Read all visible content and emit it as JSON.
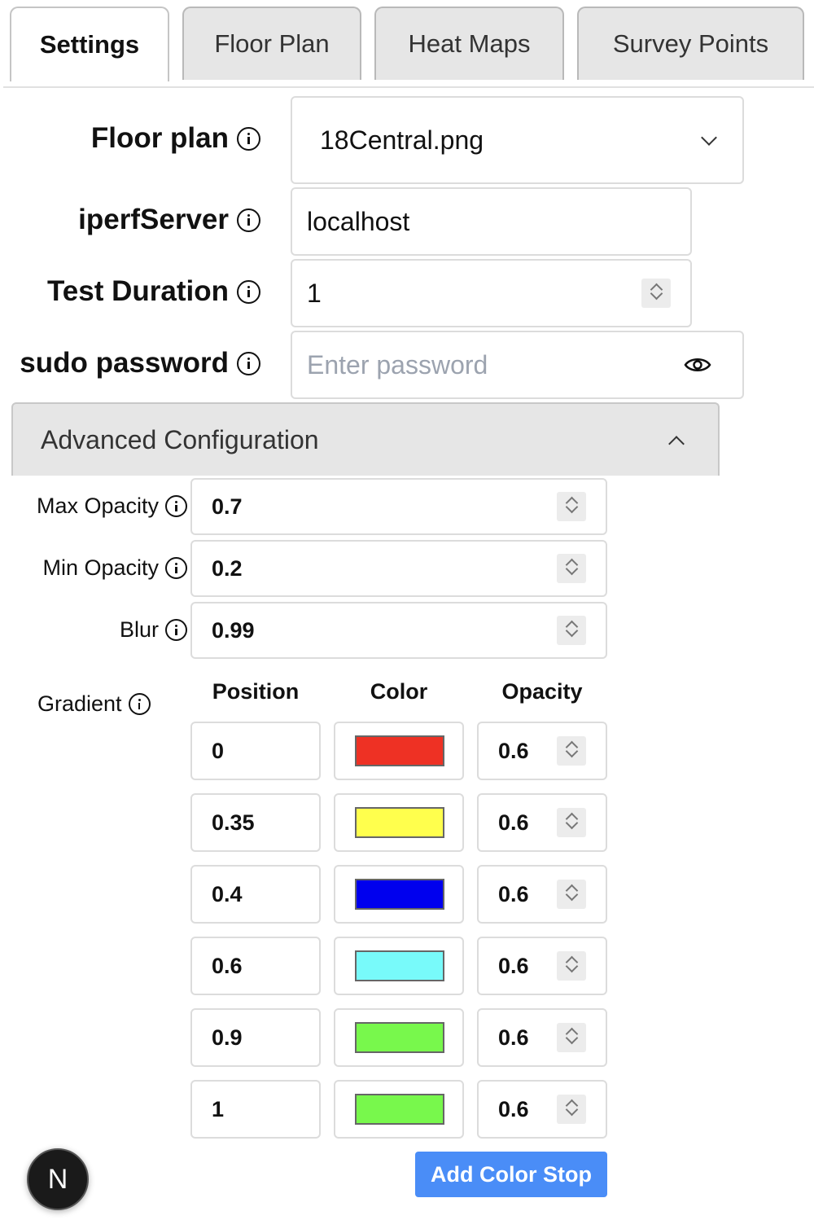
{
  "tabs": [
    {
      "label": "Settings",
      "active": true
    },
    {
      "label": "Floor Plan",
      "active": false
    },
    {
      "label": "Heat Maps",
      "active": false
    },
    {
      "label": "Survey Points",
      "active": false
    }
  ],
  "form": {
    "floor_plan": {
      "label": "Floor plan",
      "value": "18Central.png"
    },
    "iperf_server": {
      "label": "iperfServer",
      "value": "localhost"
    },
    "test_duration": {
      "label": "Test Duration",
      "value": "1"
    },
    "sudo_password": {
      "label": "sudo password",
      "placeholder": "Enter password",
      "value": ""
    }
  },
  "advanced": {
    "title": "Advanced Configuration",
    "expanded": true,
    "max_opacity": {
      "label": "Max Opacity",
      "value": "0.7"
    },
    "min_opacity": {
      "label": "Min Opacity",
      "value": "0.2"
    },
    "blur": {
      "label": "Blur",
      "value": "0.99"
    },
    "gradient": {
      "label": "Gradient",
      "headers": {
        "position": "Position",
        "color": "Color",
        "opacity": "Opacity"
      },
      "stops": [
        {
          "position": "0",
          "color": "#ee3124",
          "opacity": "0.6"
        },
        {
          "position": "0.35",
          "color": "#ffff4d",
          "opacity": "0.6"
        },
        {
          "position": "0.4",
          "color": "#0000ee",
          "opacity": "0.6"
        },
        {
          "position": "0.6",
          "color": "#78fafa",
          "opacity": "0.6"
        },
        {
          "position": "0.9",
          "color": "#78f84c",
          "opacity": "0.6"
        },
        {
          "position": "1",
          "color": "#78f84c",
          "opacity": "0.6"
        }
      ],
      "add_button": "Add Color Stop"
    }
  },
  "nextjs_badge": "N"
}
